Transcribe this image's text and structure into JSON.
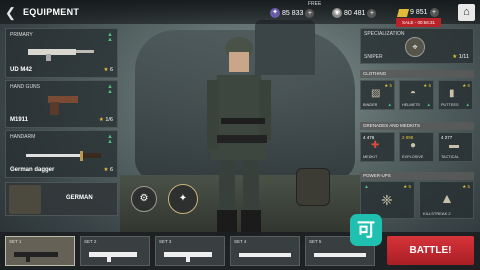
{
  "header": {
    "title": "EQUIPMENT",
    "free_label": "FREE",
    "silver": "85 833",
    "dogtags": "80 481",
    "gold": "9 851",
    "sale_label": "SALE - 00:56:31"
  },
  "loadout": {
    "primary": {
      "title": "PRIMARY",
      "name": "UD M42",
      "stars": "6"
    },
    "handguns": {
      "title": "HAND GUNS",
      "name": "M1911",
      "stars": "1/6"
    },
    "handarm": {
      "title": "HANDARM",
      "name": "German dagger",
      "stars": "6"
    }
  },
  "faction": {
    "name": "GERMAN"
  },
  "specialization": {
    "title": "SPECIALIZATION",
    "name": "SNIPER",
    "stars": "1/11"
  },
  "clothing": {
    "header": "CLOTHING",
    "items": [
      {
        "name": "BINDER",
        "stars": "5"
      },
      {
        "name": "HELMETS",
        "stars": "5"
      },
      {
        "name": "PUTTEES",
        "stars": "6"
      }
    ]
  },
  "grenades": {
    "header": "GRENADES AND MEDKITS",
    "items": [
      {
        "name": "MEDKIT",
        "count": "4 476"
      },
      {
        "name": "EXPLOSIVE",
        "count": "2 998"
      },
      {
        "name": "TACTICAL",
        "count": "4 277"
      }
    ]
  },
  "powerups": {
    "header": "POWER-UPS",
    "items": [
      {
        "name": "",
        "stars": "5"
      },
      {
        "name": "KILLSTREAK 2",
        "stars": "5"
      }
    ]
  },
  "sets": [
    {
      "label": "SET 1"
    },
    {
      "label": "SET 2"
    },
    {
      "label": "SET 3"
    },
    {
      "label": "SET 4"
    },
    {
      "label": "SET 5"
    }
  ],
  "battle_label": "BATTLE!",
  "colors": {
    "accent_red": "#c4262d",
    "stars_gold": "#e6c23a",
    "upgrade_green": "#4cc07a"
  }
}
